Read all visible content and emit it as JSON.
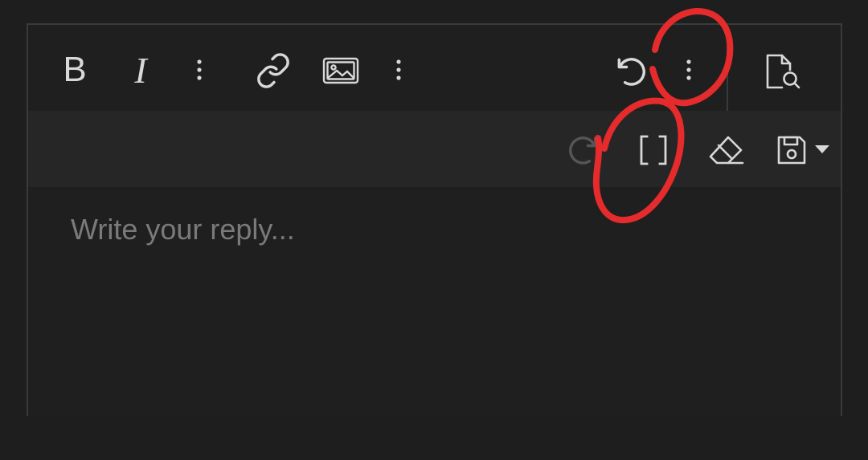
{
  "toolbar": {
    "row1": {
      "bold": {
        "icon": "bold-icon",
        "label": "B"
      },
      "italic": {
        "icon": "italic-icon",
        "label": "I"
      },
      "more_1": {
        "icon": "more-vertical-icon"
      },
      "link": {
        "icon": "link-icon"
      },
      "image": {
        "icon": "image-icon"
      },
      "more_2": {
        "icon": "more-vertical-icon"
      },
      "undo": {
        "icon": "undo-icon"
      },
      "more_3": {
        "icon": "more-vertical-icon"
      },
      "preview": {
        "icon": "file-search-icon"
      }
    },
    "row2": {
      "redo": {
        "icon": "redo-icon"
      },
      "bbcode": {
        "icon": "brackets-icon",
        "label": "[ ]"
      },
      "remove_format": {
        "icon": "eraser-icon"
      },
      "drafts": {
        "icon": "save-icon"
      },
      "drafts_dropdown": {
        "icon": "caret-down-icon"
      }
    }
  },
  "editor": {
    "placeholder": "Write your reply..."
  },
  "annotations": {
    "color": "#e52b2b",
    "count": 2
  },
  "colors": {
    "background": "#1e1e1e",
    "toolbar_row2": "#262626",
    "icon": "#d8d8d8",
    "icon_disabled": "#555555",
    "placeholder": "#7a7a7a",
    "border": "#3a3a3a"
  }
}
